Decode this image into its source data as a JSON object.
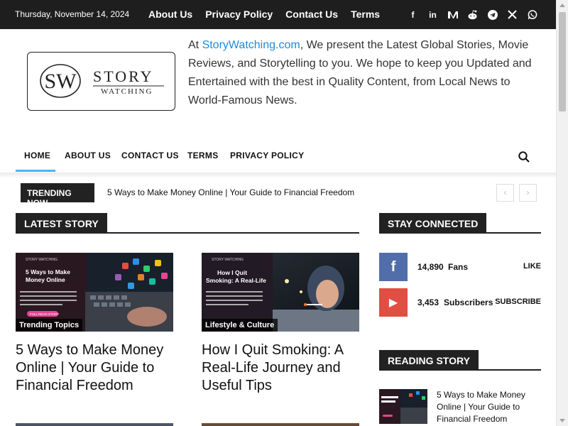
{
  "topbar": {
    "date": "Thursday, November 14, 2024",
    "links": [
      "About Us",
      "Privacy Policy",
      "Contact Us",
      "Terms"
    ],
    "social_icons": [
      "facebook-icon",
      "linkedin-icon",
      "medium-icon",
      "reddit-icon",
      "telegram-icon",
      "x-icon",
      "whatsapp-icon"
    ]
  },
  "logo": {
    "monogram": "SW",
    "word1": "STORY",
    "word2": "WATCHING"
  },
  "intro": {
    "prefix": "At ",
    "site": "StoryWatching.com",
    "text": ", We present the Latest Global Stories, Movie Reviews, and Storytelling to you. We hope to keep you Updated and Entertained with the best in Quality Content, from Local News to World-Famous News."
  },
  "nav": {
    "items": [
      "HOME",
      "ABOUT US",
      "CONTACT US",
      "TERMS",
      "PRIVACY POLICY"
    ],
    "active": "HOME",
    "search_icon": "search-icon"
  },
  "trending": {
    "badge": "TRENDING NOW",
    "headline": "5 Ways to Make Money Online | Your Guide to Financial Freedom",
    "prev": "‹",
    "next": "›"
  },
  "latest": {
    "title": "LATEST STORY",
    "articles": [
      {
        "category": "Trending Topics",
        "title": "5 Ways to Make Money Online | Your Guide to Financial Freedom",
        "thumb": {
          "brand": "STORY WATCHING",
          "heading": "5 Ways to Make Money Online",
          "cta": "FULL READ STORY"
        }
      },
      {
        "category": "Lifestyle & Culture",
        "title": "How I Quit Smoking: A Real-Life Journey and Useful Tips",
        "thumb": {
          "brand": "STORY WATCHING",
          "heading": "How I Quit Smoking: A Real-Life"
        }
      }
    ]
  },
  "stay_connected": {
    "title": "STAY CONNECTED",
    "rows": [
      {
        "icon": "facebook-icon",
        "glyph": "f",
        "color": "#516eab",
        "count": "14,890",
        "label": "Fans",
        "action": "LIKE"
      },
      {
        "icon": "youtube-icon",
        "glyph": "▶",
        "color": "#e14e42",
        "count": "3,453",
        "label": "Subscribers",
        "action": "SUBSCRIBE"
      }
    ]
  },
  "reading": {
    "title": "READING STORY",
    "item": "5 Ways to Make Money Online | Your Guide to Financial Freedom"
  }
}
